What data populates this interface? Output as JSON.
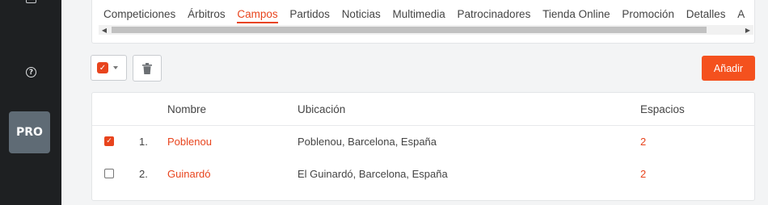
{
  "sidebar": {
    "help_glyph": "?",
    "pro_label": "PRO"
  },
  "tabs": [
    {
      "label": "Competiciones"
    },
    {
      "label": "Árbitros"
    },
    {
      "label": "Campos",
      "active": true
    },
    {
      "label": "Partidos"
    },
    {
      "label": "Noticias"
    },
    {
      "label": "Multimedia"
    },
    {
      "label": "Patrocinadores"
    },
    {
      "label": "Tienda Online"
    },
    {
      "label": "Promoción"
    },
    {
      "label": "Detalles"
    },
    {
      "label": "A"
    }
  ],
  "toolbar": {
    "add_label": "Añadir"
  },
  "table": {
    "headers": {
      "name": "Nombre",
      "location": "Ubicación",
      "spaces": "Espacios"
    },
    "rows": [
      {
        "checked": true,
        "index": "1.",
        "name": "Poblenou",
        "location": "Poblenou, Barcelona, España",
        "spaces": "2"
      },
      {
        "checked": false,
        "index": "2.",
        "name": "Guinardó",
        "location": "El Guinardó, Barcelona, España",
        "spaces": "2"
      }
    ]
  },
  "colors": {
    "accent": "#e8441d",
    "sidebar": "#1e2022",
    "pro_badge": "#5f6b75"
  }
}
